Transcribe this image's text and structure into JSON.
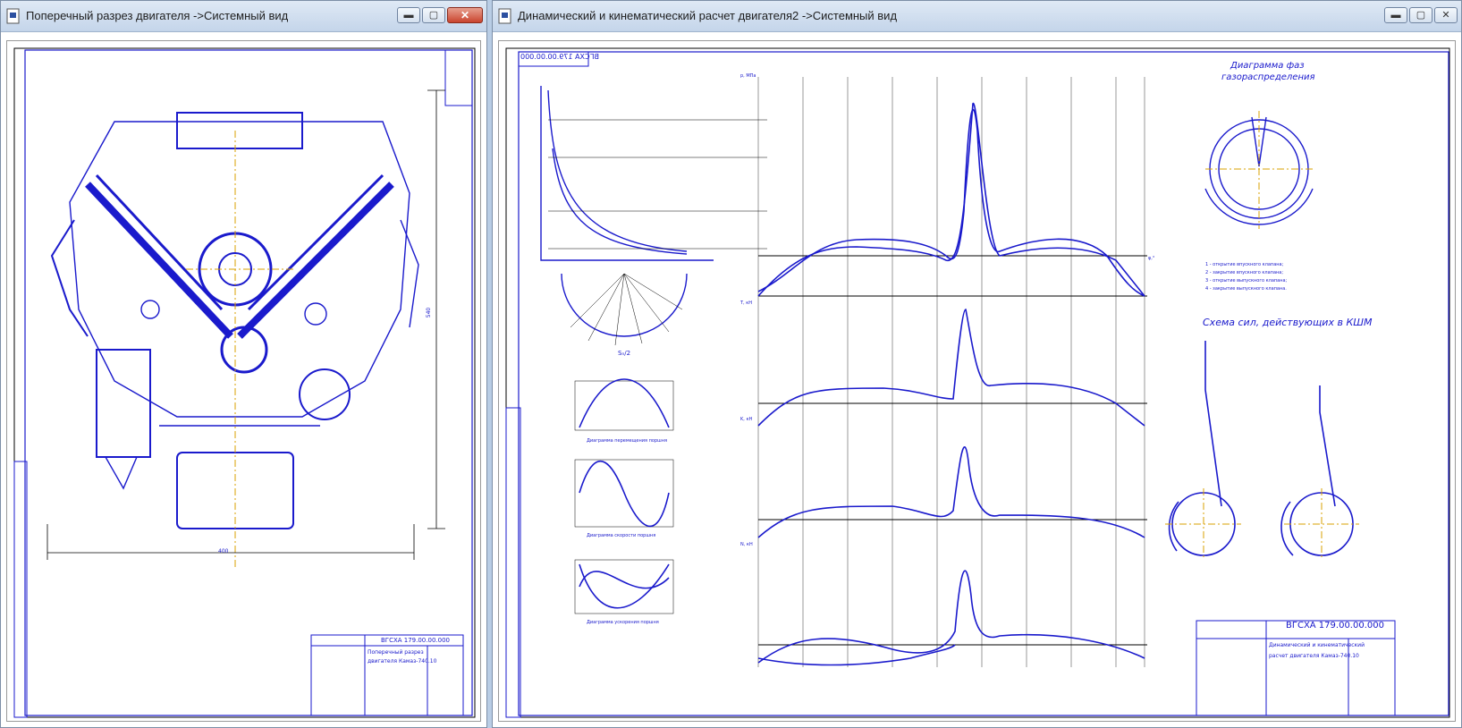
{
  "left_window": {
    "title": "Поперечный разрез двигателя ->Системный вид",
    "stamp": {
      "code": "ВГСХА 179.00.00.000",
      "title_line1": "Поперечный разрез",
      "title_line2": "двигателя Камаз-740.10"
    },
    "dimensions": {
      "width": "400",
      "height": "540"
    }
  },
  "right_window": {
    "title": "Динамический и кинематический расчет двигателя2 ->Системный вид",
    "mirror_code": "ВГСХА 179.00.00.000",
    "valve_diagram_title_line1": "Диаграмма фаз",
    "valve_diagram_title_line2": "газораспределения",
    "forces_title": "Схема сил, действующих в КШМ",
    "stamp": {
      "code": "ВГСХА 179.00.00.000",
      "title_line1": "Динамический и кинематический",
      "title_line2": "расчет двигателя Камаз-740.10"
    },
    "legend": [
      "1 - открытие впускного клапана;",
      "2 - закрытие впускного клапана;",
      "3 - открытие выпускного клапана;",
      "4 - закрытие выпускного клапана."
    ],
    "caption_accel": "Диаграмма ускорения поршня",
    "caption_speed": "Диаграмма скорости поршня",
    "caption_move": "Диаграмма перемещения поршня",
    "pi_label": "Sₙ/2",
    "labels": {
      "phi_axis": "φ,°",
      "p_axis": "p, МПа",
      "t_axis": "T, кН",
      "k_axis": "K, кН",
      "n_axis": "N, кН"
    }
  },
  "window_buttons": {
    "minimize": "▬",
    "maximize": "▢",
    "close": "✕"
  },
  "colors": {
    "drawing": "#1a1acc",
    "frame": "#000000",
    "gold": "#d8a000"
  }
}
